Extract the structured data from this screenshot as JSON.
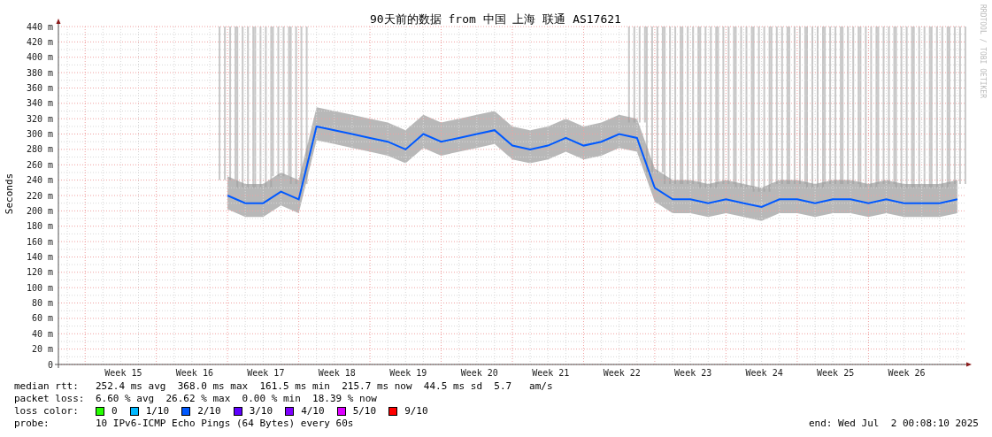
{
  "chart": {
    "chart_data": {
      "type": "line",
      "title": "90天前的数据 from 中国 上海 联通 AS17621",
      "ylabel": "Seconds",
      "categories": [
        null,
        null,
        null,
        "Week 15",
        null,
        null,
        null,
        "Week 16",
        null,
        null,
        null,
        "Week 17",
        null,
        null,
        null,
        "Week 18",
        null,
        null,
        null,
        "Week 19",
        null,
        null,
        null,
        "Week 20",
        null,
        null,
        null,
        "Week 21",
        null,
        null,
        null,
        "Week 22",
        null,
        null,
        null,
        "Week 23",
        null,
        null,
        null,
        "Week 24",
        null,
        null,
        null,
        "Week 25",
        null,
        null,
        null,
        "Week 26",
        null,
        null,
        null
      ],
      "series": [
        {
          "color": "#0059ff",
          "values": [
            null,
            null,
            null,
            null,
            null,
            null,
            null,
            null,
            null,
            220,
            210,
            210,
            225,
            215,
            310,
            305,
            300,
            295,
            290,
            280,
            300,
            290,
            295,
            300,
            305,
            285,
            280,
            285,
            295,
            285,
            290,
            300,
            295,
            230,
            215,
            215,
            210,
            215,
            210,
            205,
            215,
            215,
            210,
            215,
            215,
            210,
            215,
            210,
            210,
            210,
            215
          ]
        }
      ],
      "ylim": [
        0,
        440
      ],
      "grid": true,
      "yticks": [
        {
          "value": 0,
          "label": "0"
        },
        {
          "value": 20,
          "label": "20 m"
        },
        {
          "value": 40,
          "label": "40 m"
        },
        {
          "value": 60,
          "label": "60 m"
        },
        {
          "value": 80,
          "label": "80 m"
        },
        {
          "value": 100,
          "label": "100 m"
        },
        {
          "value": 120,
          "label": "120 m"
        },
        {
          "value": 140,
          "label": "140 m"
        },
        {
          "value": 160,
          "label": "160 m"
        },
        {
          "value": 180,
          "label": "180 m"
        },
        {
          "value": 200,
          "label": "200 m"
        },
        {
          "value": 220,
          "label": "220 m"
        },
        {
          "value": 240,
          "label": "240 m"
        },
        {
          "value": 260,
          "label": "260 m"
        },
        {
          "value": 280,
          "label": "280 m"
        },
        {
          "value": 300,
          "label": "300 m"
        },
        {
          "value": 320,
          "label": "320 m"
        },
        {
          "value": 340,
          "label": "340 m"
        },
        {
          "value": 360,
          "label": "360 m"
        },
        {
          "value": 380,
          "label": "380 m"
        },
        {
          "value": 400,
          "label": "400 m"
        },
        {
          "value": 420,
          "label": "420 m"
        },
        {
          "value": 440,
          "label": "440 m"
        }
      ]
    },
    "credit": "RRDTOOL / TOBI OETIKER"
  },
  "stats": [
    {
      "label": "median rtt:",
      "value": "252.4 ms avg  368.0 ms max  161.5 ms min  215.7 ms now  44.5 ms sd  5.7   am/s"
    },
    {
      "label": "packet loss:",
      "value": "6.60 % avg  26.62 % max  0.00 % min  18.39 % now"
    }
  ],
  "loss_colors": {
    "label": "loss color:",
    "items": [
      {
        "label": "0",
        "color": "#26ff00"
      },
      {
        "label": "1/10",
        "color": "#00b8ff"
      },
      {
        "label": "2/10",
        "color": "#0059ff"
      },
      {
        "label": "3/10",
        "color": "#5e00ff"
      },
      {
        "label": "4/10",
        "color": "#7e00ff"
      },
      {
        "label": "5/10",
        "color": "#dd00ff"
      },
      {
        "label": "9/10",
        "color": "#ff0000"
      }
    ]
  },
  "probe": {
    "label": "probe:",
    "value": "10 IPv6-ICMP Echo Pings (64 Bytes) every 60s"
  },
  "end": "end: Wed Jul  2 00:08:10 2025"
}
